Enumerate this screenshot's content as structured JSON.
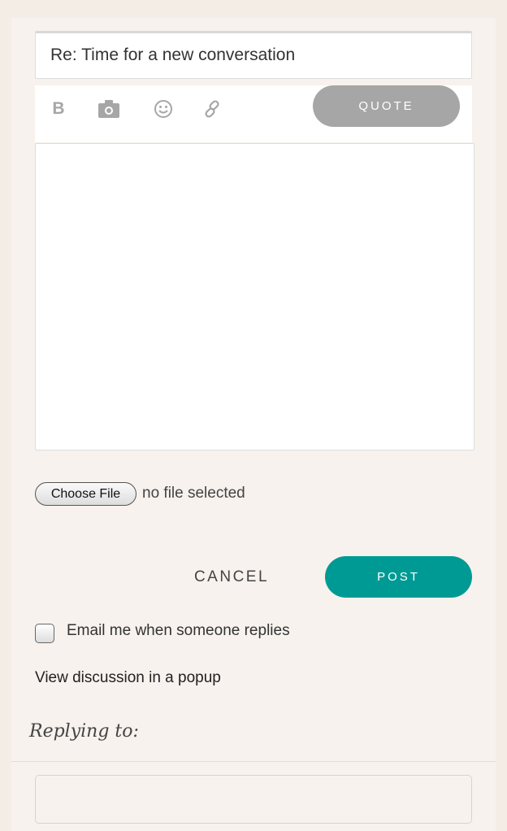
{
  "form": {
    "subject_value": "Re: Time for a new conversation",
    "toolbar": {
      "icons": [
        "bold-icon",
        "camera-icon",
        "emoji-icon",
        "link-icon"
      ],
      "bold_glyph": "B",
      "quote_label": "QUOTE"
    },
    "choose_file_label": "Choose File",
    "file_status": "no file selected",
    "cancel_label": "CANCEL",
    "post_label": "POST",
    "email_notify_label": "Email me when someone replies",
    "email_notify_checked": false,
    "popup_link": "View discussion in a popup"
  },
  "replying_to_label": "Replying to:",
  "colors": {
    "accent": "#009a94",
    "quote_button": "#a6a6a6",
    "background": "#f3ede6"
  }
}
